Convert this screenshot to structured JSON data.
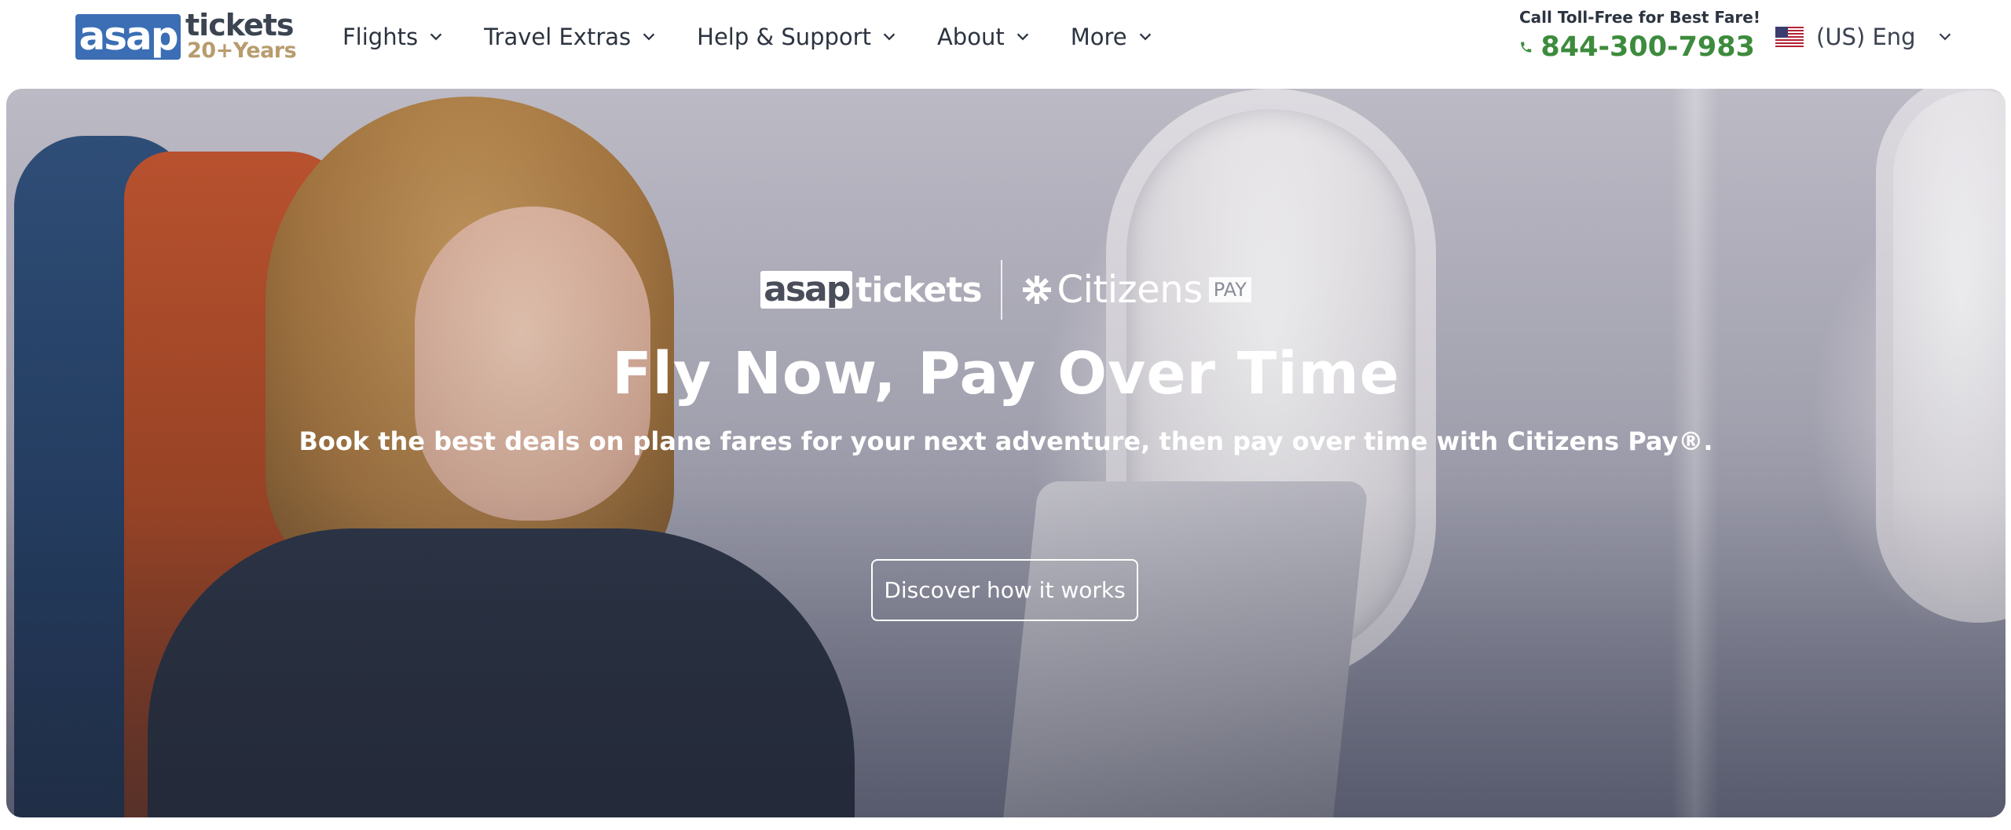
{
  "header": {
    "logo": {
      "wordmark": "asap",
      "product": "tickets",
      "tagline": "20+Years",
      "icon": "asap-tickets-logo"
    },
    "nav": [
      {
        "label": "Flights",
        "icon": "chevron-down-icon"
      },
      {
        "label": "Travel Extras",
        "icon": "chevron-down-icon"
      },
      {
        "label": "Help & Support",
        "icon": "chevron-down-icon"
      },
      {
        "label": "About",
        "icon": "chevron-down-icon"
      },
      {
        "label": "More",
        "icon": "chevron-down-icon"
      }
    ],
    "call": {
      "label": "Call Toll-Free for Best Fare!",
      "phone": "844-300-7983",
      "icon": "phone-icon"
    },
    "language": {
      "label": "(US) Eng",
      "flag": "us-flag-icon"
    }
  },
  "hero": {
    "partners": {
      "asap_box": "asap",
      "asap_tickets": "tickets",
      "citizens_name": "Citizens",
      "citizens_pay": "PAY"
    },
    "title": "Fly Now, Pay Over Time",
    "subtitle": "Book the best deals on plane fares for your next adventure, then pay over time with Citizens Pay®.",
    "cta_label": "Discover how it works"
  },
  "colors": {
    "brand_blue": "#3b6eb4",
    "brand_gold": "#b89c6e",
    "phone_green": "#3d8b3d",
    "text_dark": "#2c3440"
  }
}
